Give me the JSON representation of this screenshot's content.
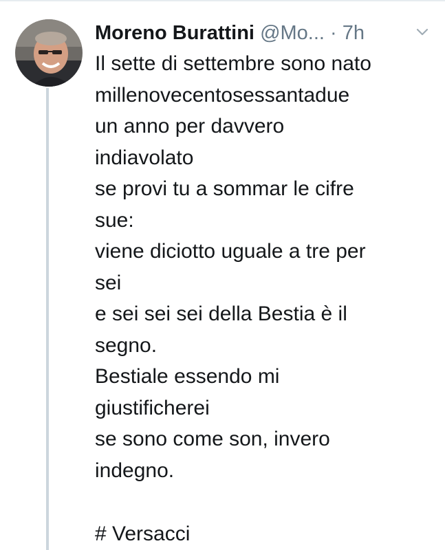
{
  "tweet": {
    "author_name": "Moreno Burattini",
    "author_handle": "@Mo...",
    "separator": "·",
    "timestamp": "7h",
    "lines": [
      "Il sette di settembre sono nato",
      "millenovecentosessantadue",
      "un anno per davvero",
      "indiavolato",
      "se provi tu a sommar le cifre",
      "sue:",
      "viene diciotto uguale a tre per",
      "sei",
      "e sei sei sei della Bestia è il",
      "segno.",
      "Bestiale essendo mi",
      "giustificherei",
      "se sono come son, invero",
      "indegno."
    ],
    "hashtag": "# Versacci"
  },
  "icons": {
    "avatar": "user-avatar-photo",
    "menu": "chevron-down-icon"
  },
  "colors": {
    "text": "#14171a",
    "secondary_text": "#657786",
    "thread_line": "#ccd6dd"
  }
}
